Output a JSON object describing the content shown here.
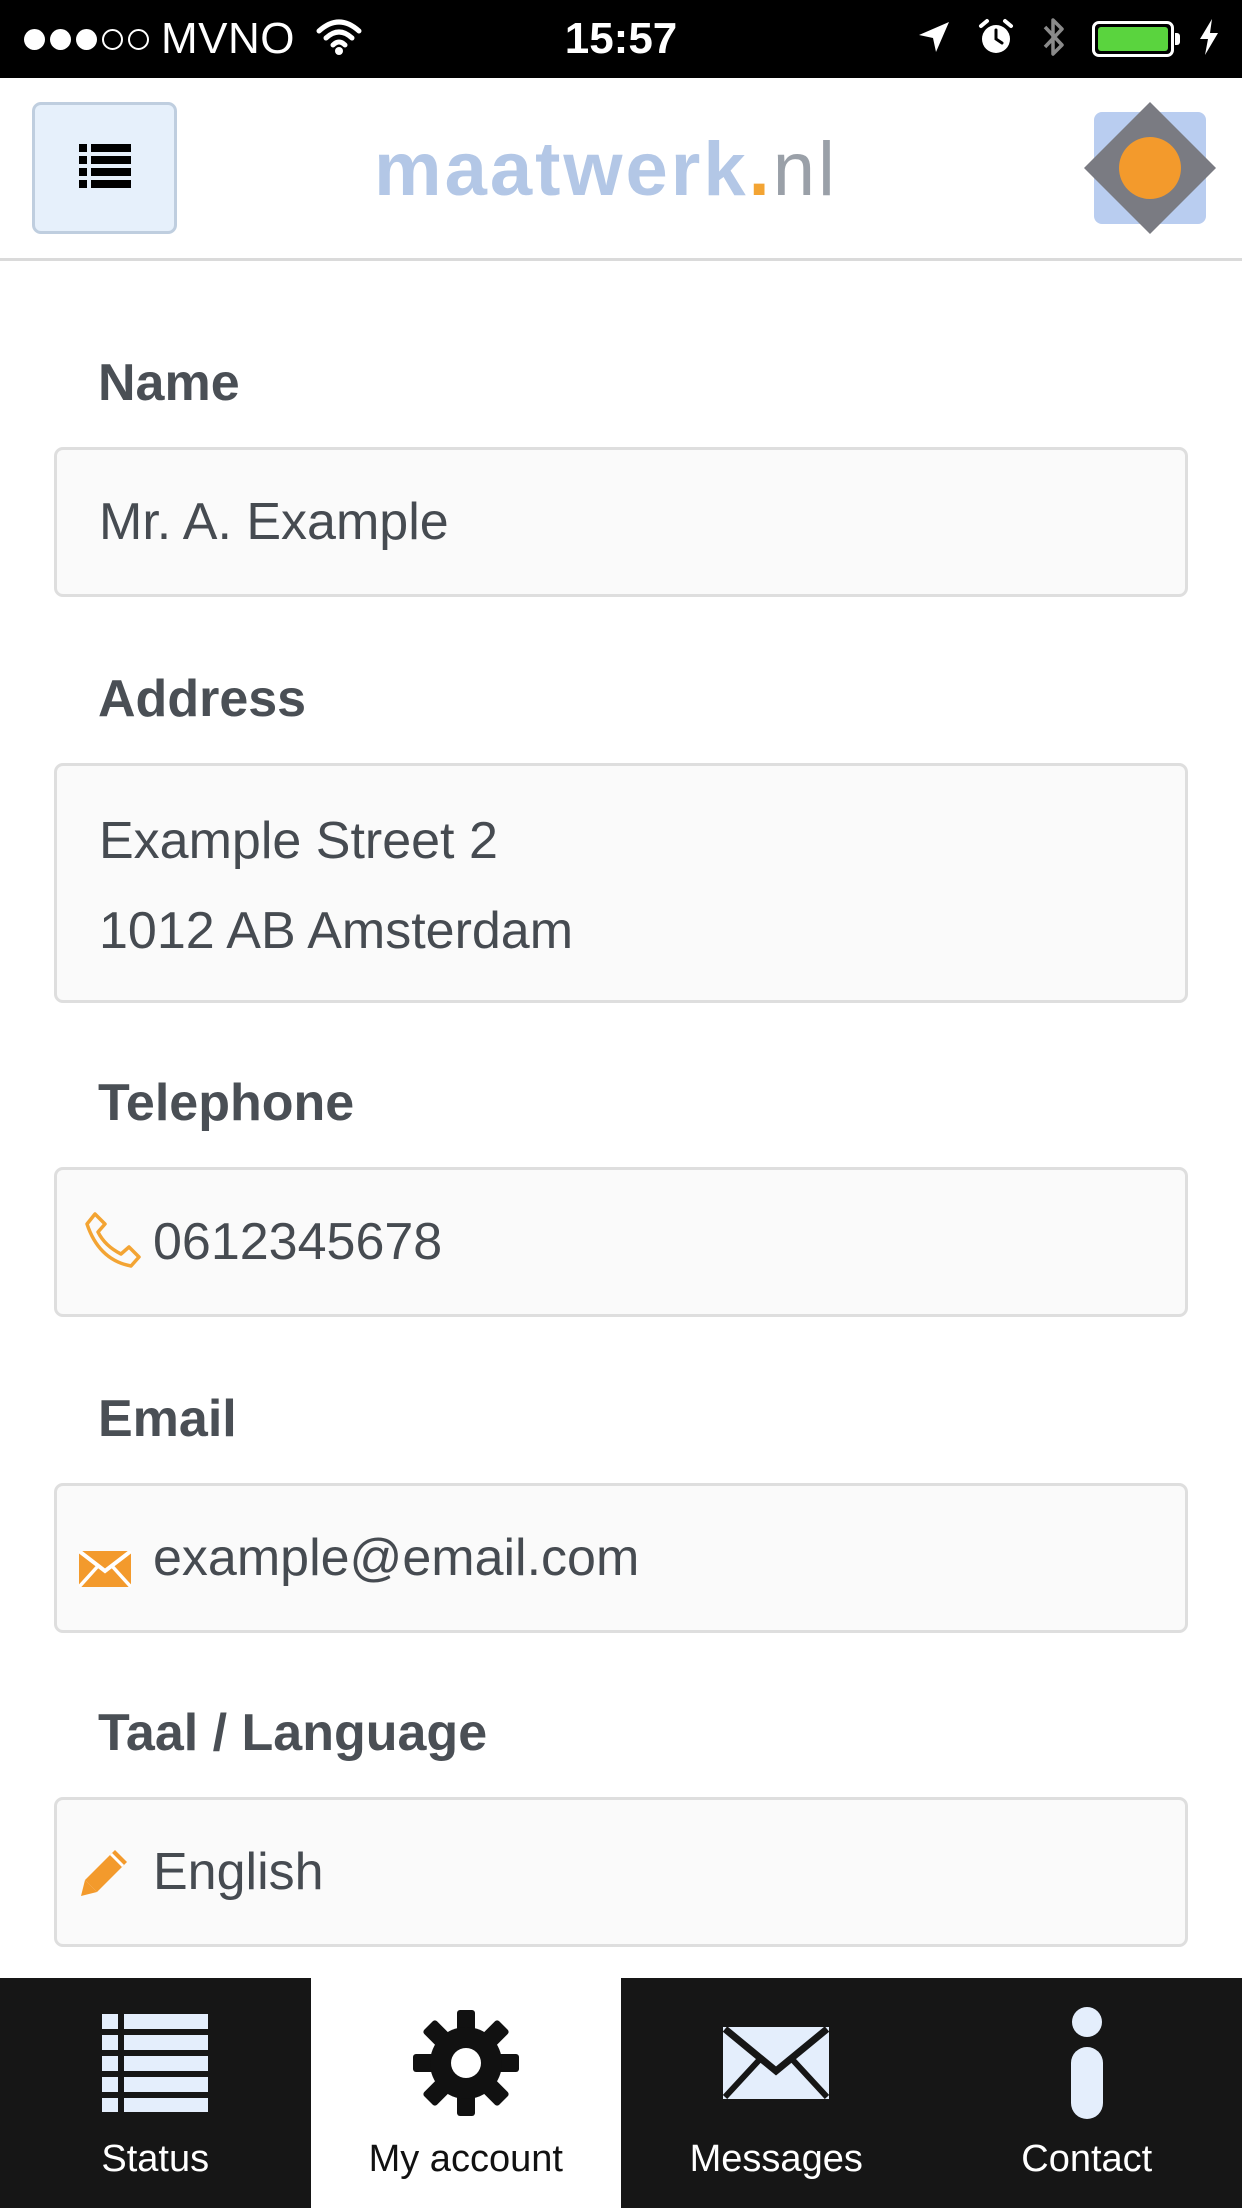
{
  "status_bar": {
    "signal": {
      "filled": 3,
      "empty": 2
    },
    "carrier": "MVNO",
    "time": "15:57",
    "battery_color": "#5ad43e"
  },
  "header": {
    "menu_icon": "list-icon",
    "brand_name": "maatwerk",
    "brand_dot": ".",
    "brand_tld": "nl",
    "logo_icon": "diamond-logo-icon"
  },
  "form": {
    "name": {
      "label": "Name",
      "value": "Mr. A. Example"
    },
    "address": {
      "label": "Address",
      "line1": "Example Street 2",
      "line2": "1012 AB Amsterdam"
    },
    "telephone": {
      "label": "Telephone",
      "value": "0612345678",
      "icon": "phone-icon"
    },
    "email": {
      "label": "Email",
      "value": "example@email.com",
      "icon": "envelope-icon"
    },
    "language": {
      "label": "Taal / Language",
      "value": "English",
      "icon": "pencil-icon"
    }
  },
  "tabs": [
    {
      "label": "Status",
      "icon": "list-icon",
      "active": false
    },
    {
      "label": "My account",
      "icon": "gear-icon",
      "active": true
    },
    {
      "label": "Messages",
      "icon": "envelope-icon",
      "active": false
    },
    {
      "label": "Contact",
      "icon": "info-icon",
      "active": false
    }
  ],
  "colors": {
    "accent_orange": "#f3a433",
    "brand_blue": "#b3c7e6",
    "tab_bar_bg": "#161616",
    "icon_light_blue": "#e4eefc"
  }
}
